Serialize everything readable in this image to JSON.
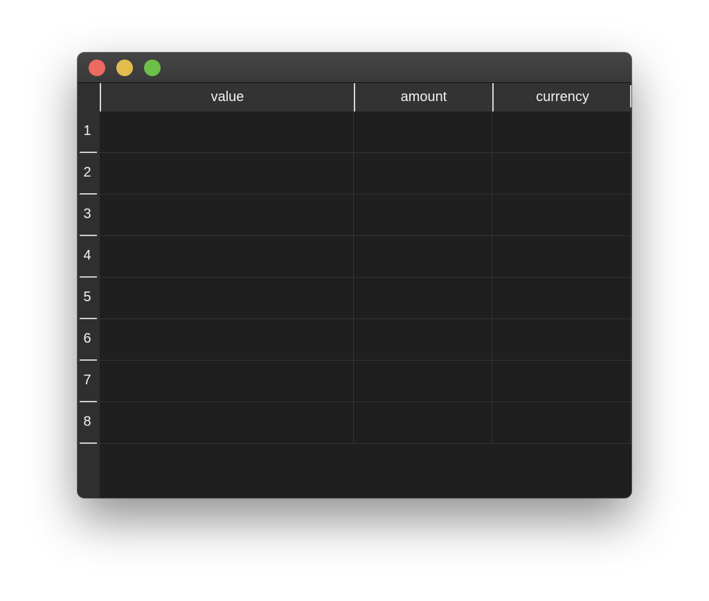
{
  "window": {
    "controls": [
      "close",
      "minimize",
      "zoom"
    ],
    "colors": {
      "close": "#ed6a5e",
      "minimize": "#e2bd4e",
      "zoom": "#6cbf47",
      "background": "#1f1f1f"
    }
  },
  "table": {
    "columns": [
      {
        "label": "value"
      },
      {
        "label": "amount"
      },
      {
        "label": "currency"
      }
    ],
    "rows": [
      {
        "label": "1",
        "cells": [
          "",
          "",
          ""
        ]
      },
      {
        "label": "2",
        "cells": [
          "",
          "",
          ""
        ]
      },
      {
        "label": "3",
        "cells": [
          "",
          "",
          ""
        ]
      },
      {
        "label": "4",
        "cells": [
          "",
          "",
          ""
        ]
      },
      {
        "label": "5",
        "cells": [
          "",
          "",
          ""
        ]
      },
      {
        "label": "6",
        "cells": [
          "",
          "",
          ""
        ]
      },
      {
        "label": "7",
        "cells": [
          "",
          "",
          ""
        ]
      },
      {
        "label": "8",
        "cells": [
          "",
          "",
          ""
        ]
      }
    ]
  }
}
